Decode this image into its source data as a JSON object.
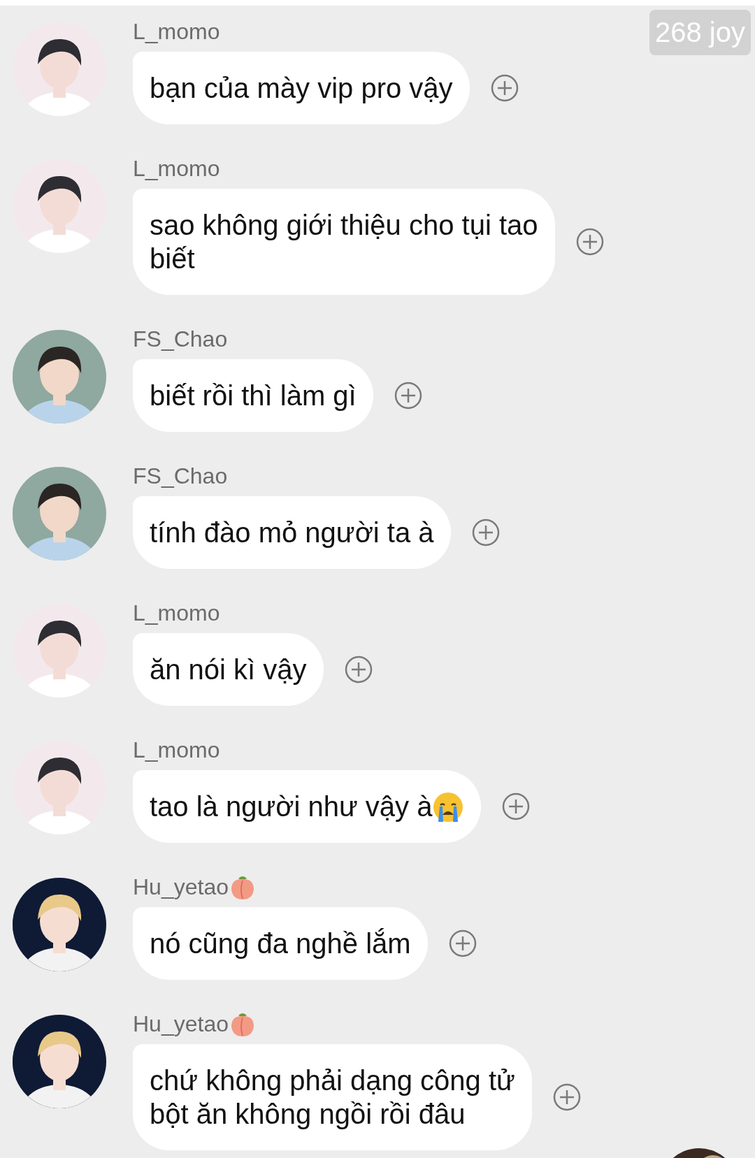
{
  "badge": "268 joy",
  "messages": [
    {
      "sender": "L_momo",
      "kind": "plain",
      "lines": [
        "bạn của mày vip pro vậy"
      ]
    },
    {
      "sender": "L_momo",
      "kind": "plain",
      "lines": [
        "sao không giới thiệu cho tụi tao",
        "biết"
      ]
    },
    {
      "sender": "FS_Chao",
      "kind": "plain",
      "lines": [
        "biết rồi thì làm gì"
      ]
    },
    {
      "sender": "FS_Chao",
      "kind": "plain",
      "lines": [
        "tính đào mỏ người ta à"
      ]
    },
    {
      "sender": "L_momo",
      "kind": "plain",
      "lines": [
        "ăn nói kì vậy"
      ]
    },
    {
      "sender": "L_momo",
      "kind": "tearful",
      "lines": [
        "tao là người như vậy à"
      ]
    },
    {
      "sender": "Hu_yetao",
      "kind": "peach",
      "lines": [
        "nó cũng đa nghề lắm"
      ]
    },
    {
      "sender": "Hu_yetao",
      "kind": "peach",
      "lines": [
        "chứ không phải dạng công tử",
        "bột ăn không ngồi rồi đâu"
      ]
    }
  ]
}
